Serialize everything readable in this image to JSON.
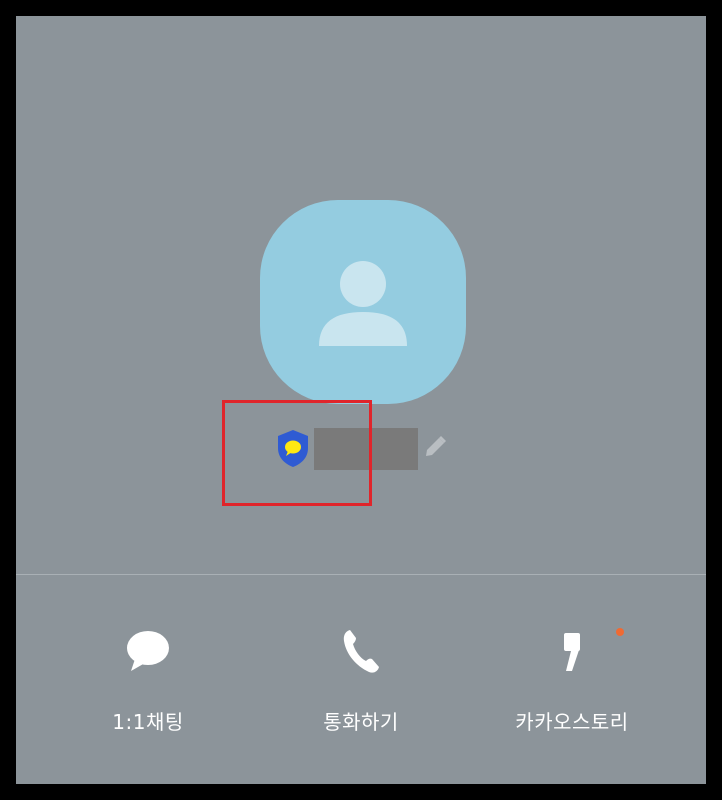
{
  "profile": {
    "name_redacted": "",
    "avatar_color": "#94cce0",
    "badge_icon": "kakao-shield-icon",
    "edit_icon": "pencil-icon"
  },
  "actions": [
    {
      "label": "1:1채팅",
      "icon": "chat-bubble-icon"
    },
    {
      "label": "통화하기",
      "icon": "phone-icon"
    },
    {
      "label": "카카오스토리",
      "icon": "kakaostory-icon",
      "has_new_badge": true
    }
  ],
  "colors": {
    "background": "#8c949a",
    "highlight": "#e0252b",
    "new_dot": "#f06a33"
  }
}
